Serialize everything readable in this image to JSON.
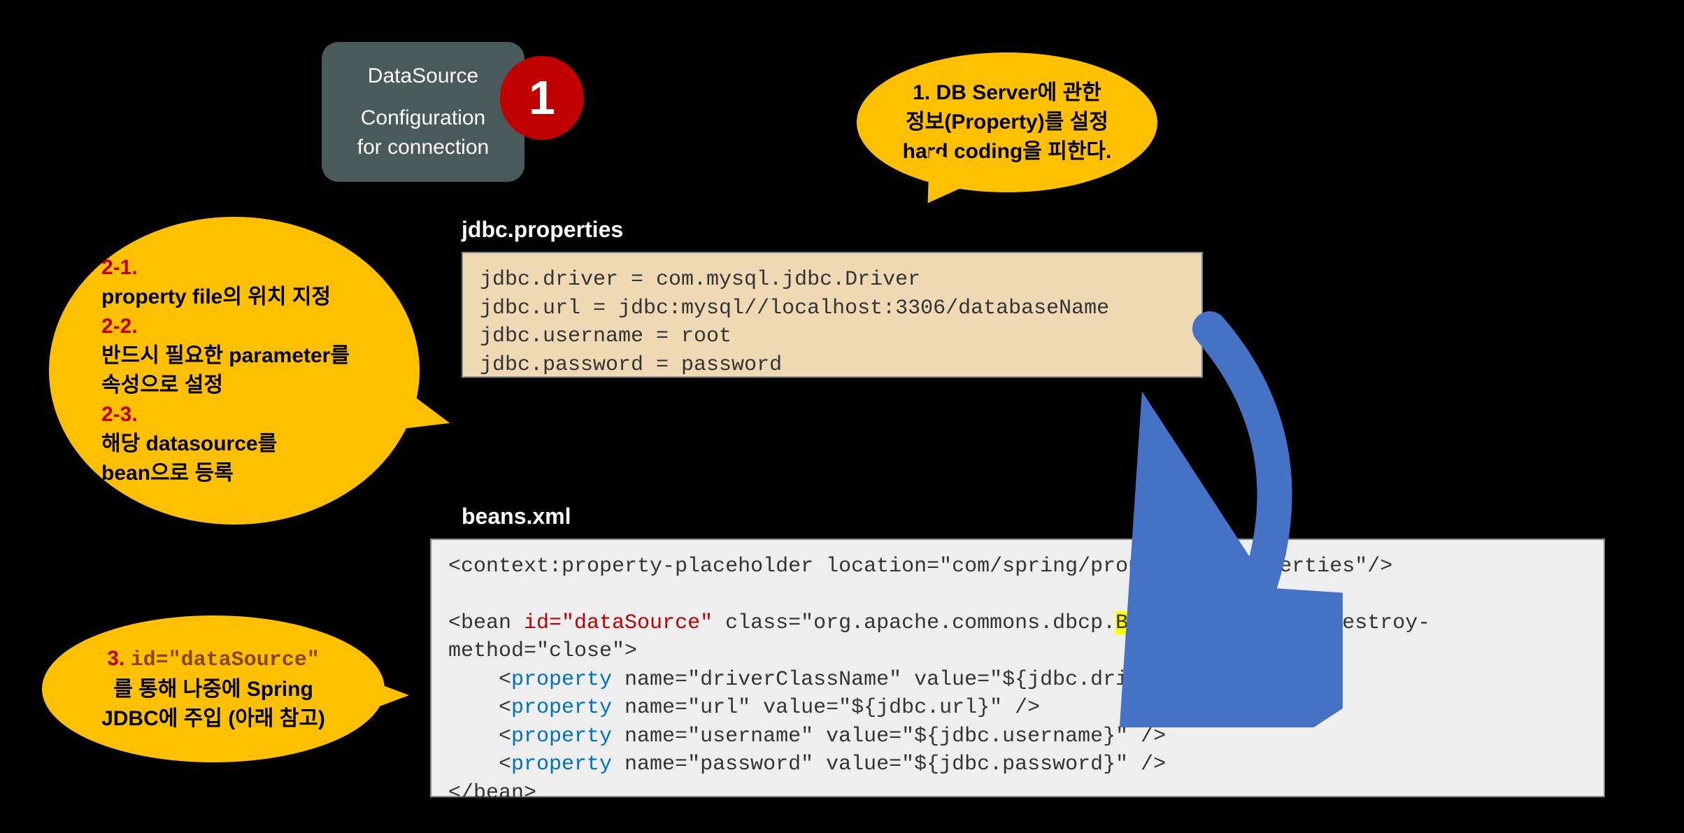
{
  "datasource_box": {
    "title": "DataSource",
    "subtitle1": "Configuration",
    "subtitle2": "for connection"
  },
  "number_badge": "1",
  "bubble1": {
    "line1": "1. DB Server에 관한",
    "line2": "정보(Property)를 설정",
    "line3": "hard coding을 피한다."
  },
  "bubble2": {
    "h1": "2-1.",
    "l1": "property file의 위치 지정",
    "h2": "2-2.",
    "l2a": "반드시 필요한 parameter를",
    "l2b": "속성으로 설정",
    "h3": "2-3.",
    "l3a": "해당 datasource를",
    "l3b": "bean으로 등록"
  },
  "bubble3": {
    "prefix": "3. ",
    "id_text": "id=\"dataSource\"",
    "line2": "를 통해 나중에 Spring",
    "line3": "JDBC에 주입 (아래 참고)"
  },
  "labels": {
    "props": "jdbc.properties",
    "beans": "beans.xml"
  },
  "code_props": {
    "l1": "jdbc.driver = com.mysql.jdbc.Driver",
    "l2": "jdbc.url = jdbc:mysql//localhost:3306/databaseName",
    "l3": "jdbc.username = root",
    "l4": "jdbc.password = password"
  },
  "code_beans": {
    "l1": "<context:property-placeholder location=\"com/spring/props/jdbc.properties\"/>",
    "l2_a": "<bean ",
    "l2_id": "id=\"dataSource\"",
    "l2_b": " class=\"org.apache.commons.dbcp.",
    "l2_hl": "BasicDataSource",
    "l2_c": "\" destroy-method=\"close\">",
    "l3_a": "    <",
    "l3_p": "property",
    "l3_b": " name=\"driverClassName\" value=\"${jdbc.driver}\" />",
    "l4_a": "    <",
    "l4_p": "property",
    "l4_b": " name=\"url\" value=\"${jdbc.url}\" />",
    "l5_a": "    <",
    "l5_p": "property",
    "l5_b": " name=\"username\" value=\"${jdbc.username}\" />",
    "l6_a": "    <",
    "l6_p": "property",
    "l6_b": " name=\"password\" value=\"${jdbc.password}\" />",
    "l7": "</bean>"
  }
}
